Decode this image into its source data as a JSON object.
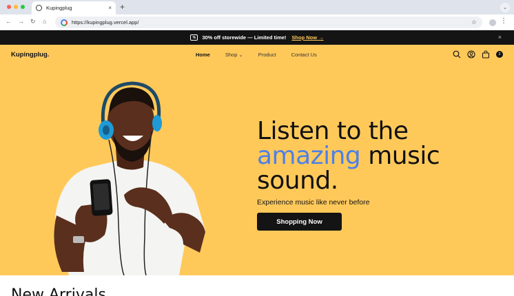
{
  "browser": {
    "tab_title": "Kupingplug",
    "tab_close": "×",
    "new_tab": "+",
    "tab_menu": "⌄",
    "url": "https://kupingplug.vercel.app/",
    "star": "☆",
    "kebab": "⋮",
    "back": "←",
    "forward": "→",
    "reload": "↻",
    "home": "⌂"
  },
  "announcement": {
    "text": "30% off storewide — Limited time!",
    "link": "Shop Now →",
    "close": "×"
  },
  "header": {
    "logo": "Kupingplug.",
    "nav": [
      {
        "label": "Home"
      },
      {
        "label": "Shop ⌄"
      },
      {
        "label": "Product"
      },
      {
        "label": "Contact Us"
      }
    ],
    "cart_count": "2"
  },
  "hero": {
    "line1": "Listen to the",
    "highlight": "amazing",
    "line2_rest": " music",
    "line3": "sound.",
    "subtitle": "Experience music like never before",
    "cta": "Shopping Now"
  },
  "section": {
    "title": "New Arrivals"
  },
  "colors": {
    "hero_bg": "#ffc95a",
    "accent_blue": "#4c80e9",
    "dark": "#141414"
  }
}
